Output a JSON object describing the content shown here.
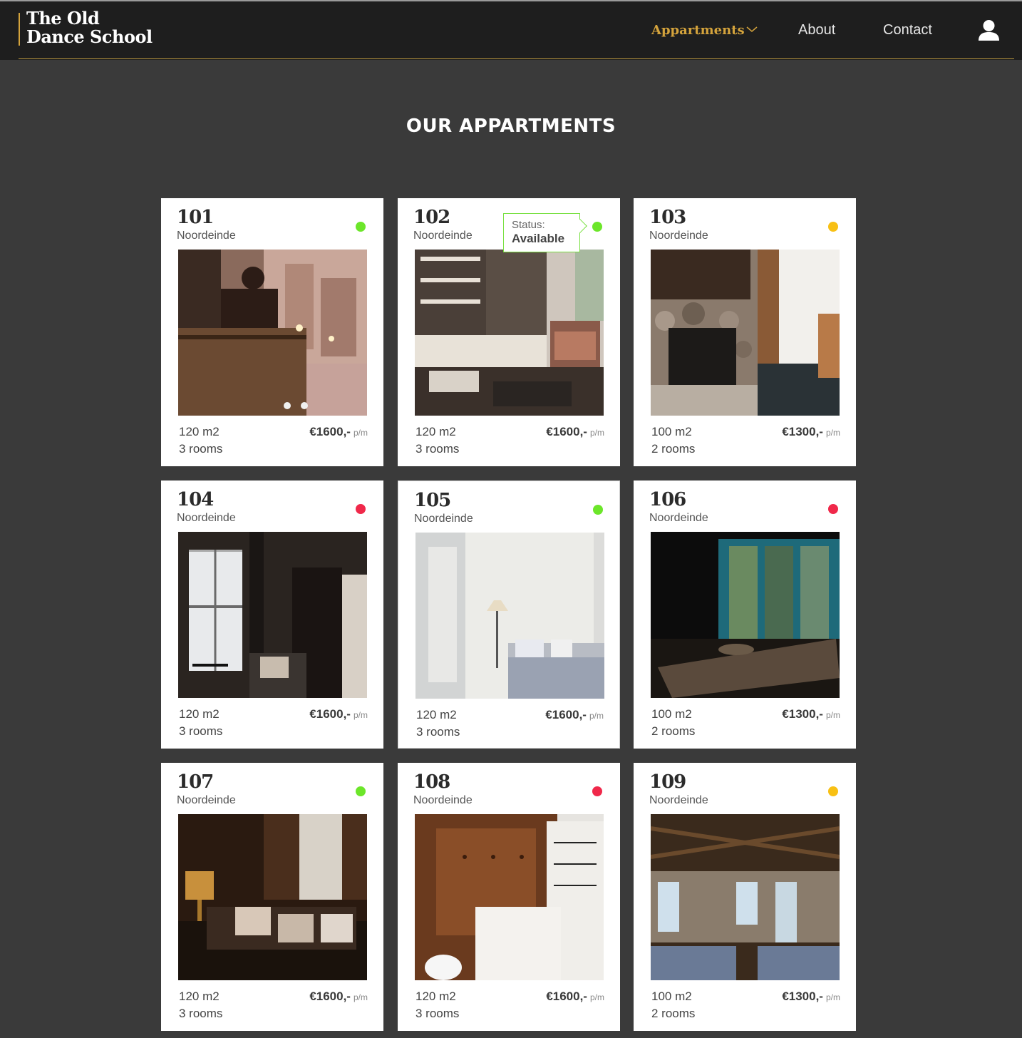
{
  "brand": {
    "line1": "The Old",
    "line2": "Dance School"
  },
  "nav": {
    "appartments": "Appartments",
    "about": "About",
    "contact": "Contact",
    "active_color": "#d4a33c"
  },
  "page": {
    "title": "OUR APPARTMENTS"
  },
  "status_colors": {
    "available": "#6ce62a",
    "reserved": "#f8c014",
    "taken": "#f0284a"
  },
  "tooltip": {
    "label": "Status:",
    "value": "Available"
  },
  "cards": [
    {
      "number": "101",
      "street": "Noordeinde",
      "area": "120 m2",
      "rooms": "3 rooms",
      "price": "€1600,-",
      "per": "p/m",
      "status": "available",
      "photo": "balcony-evening-street"
    },
    {
      "number": "102",
      "street": "Noordeinde",
      "area": "120 m2",
      "rooms": "3 rooms",
      "price": "€1600,-",
      "per": "p/m",
      "status": "available",
      "photo": "study-bookshelf-armchair"
    },
    {
      "number": "103",
      "street": "Noordeinde",
      "area": "100 m2",
      "rooms": "2 rooms",
      "price": "€1300,-",
      "per": "p/m",
      "status": "reserved",
      "photo": "stone-fireplace"
    },
    {
      "number": "104",
      "street": "Noordeinde",
      "area": "120 m2",
      "rooms": "3 rooms",
      "price": "€1600,-",
      "per": "p/m",
      "status": "taken",
      "photo": "dark-window-reading-nook"
    },
    {
      "number": "105",
      "street": "Noordeinde",
      "area": "120 m2",
      "rooms": "3 rooms",
      "price": "€1600,-",
      "per": "p/m",
      "status": "available",
      "photo": "bright-bedroom-curtains"
    },
    {
      "number": "106",
      "street": "Noordeinde",
      "area": "100 m2",
      "rooms": "2 rooms",
      "price": "€1300,-",
      "per": "p/m",
      "status": "taken",
      "photo": "teal-window-wooden-table"
    },
    {
      "number": "107",
      "street": "Noordeinde",
      "area": "120 m2",
      "rooms": "3 rooms",
      "price": "€1600,-",
      "per": "p/m",
      "status": "available",
      "photo": "cozy-lamp-sofa"
    },
    {
      "number": "108",
      "street": "Noordeinde",
      "area": "120 m2",
      "rooms": "3 rooms",
      "price": "€1600,-",
      "per": "p/m",
      "status": "taken",
      "photo": "leather-chair-pillow"
    },
    {
      "number": "109",
      "street": "Noordeinde",
      "area": "100 m2",
      "rooms": "2 rooms",
      "price": "€1300,-",
      "per": "p/m",
      "status": "reserved",
      "photo": "timber-beam-bedroom"
    }
  ]
}
